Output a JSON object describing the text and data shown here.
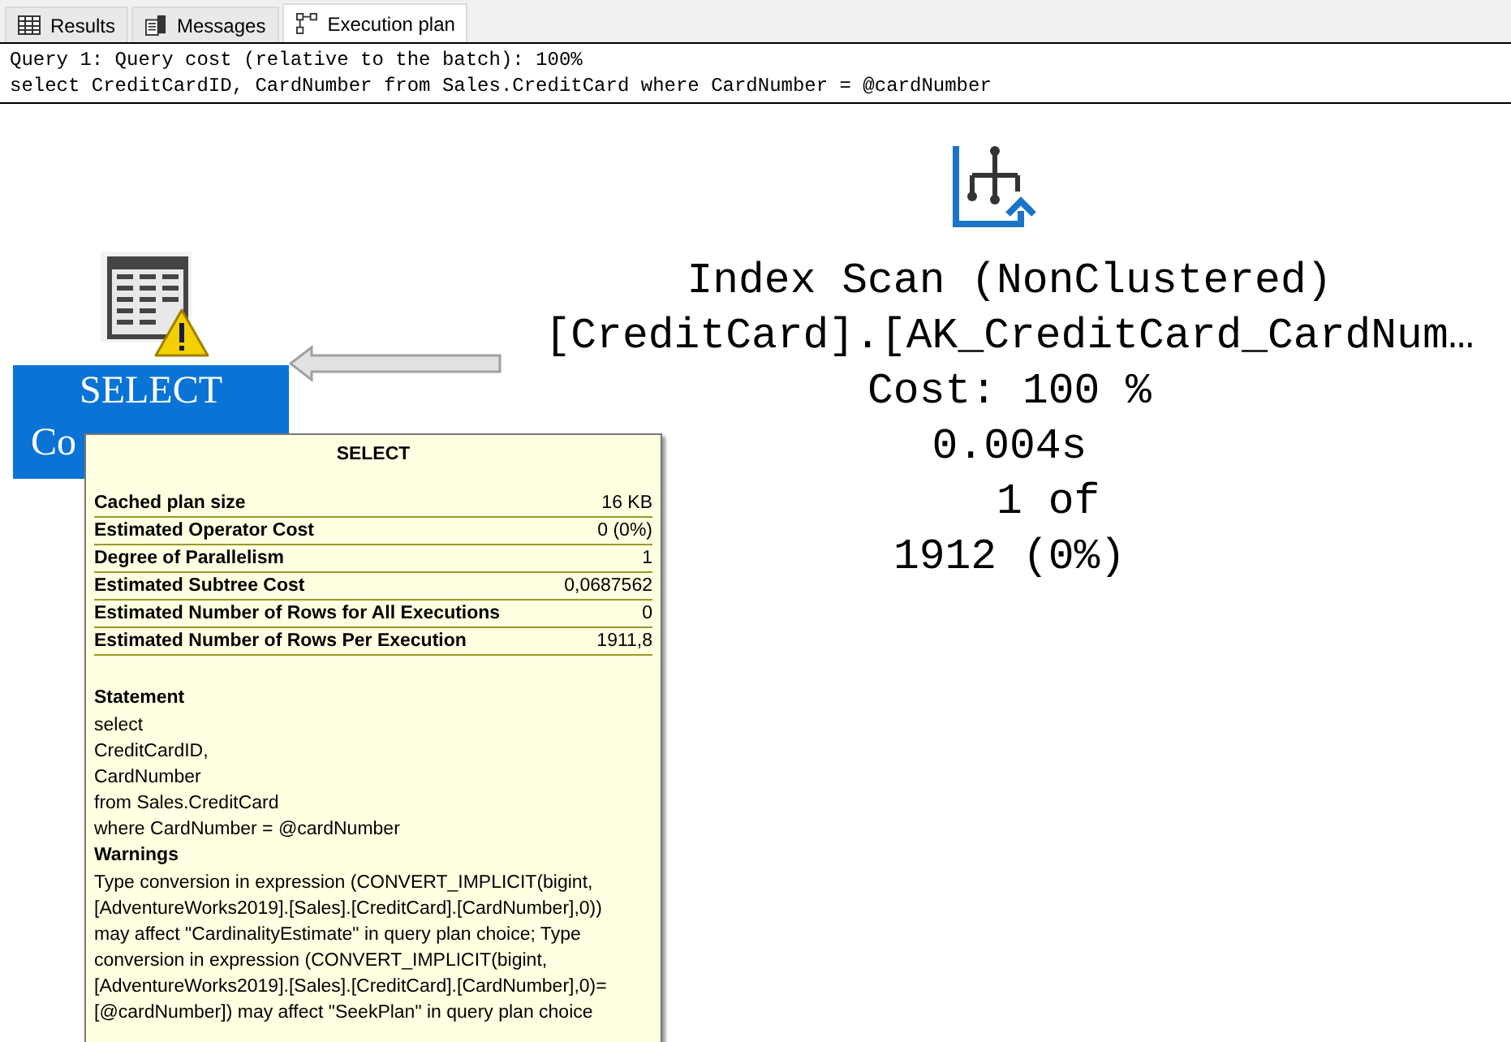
{
  "tabs": [
    {
      "label": "Results",
      "kind": "grid",
      "selected": false
    },
    {
      "label": "Messages",
      "kind": "messages",
      "selected": false
    },
    {
      "label": "Execution plan",
      "kind": "plan",
      "selected": true
    }
  ],
  "query_header": [
    "Query 1: Query cost (relative to the batch): 100%",
    "select CreditCardID, CardNumber from Sales.CreditCard where CardNumber = @cardNumber"
  ],
  "plan": {
    "select_node": {
      "lines": [
        "SELECT",
        "Co"
      ],
      "selected": true,
      "warning": true
    },
    "scan_node": {
      "lines": [
        "Index Scan (NonClustered)",
        "[CreditCard].[AK_CreditCard_CardNum…",
        "Cost: 100 %",
        "0.004s",
        "   1 of",
        "1912 (0%)"
      ]
    }
  },
  "tooltip": {
    "title": "SELECT",
    "properties": [
      {
        "name": "Cached plan size",
        "value": "16 KB"
      },
      {
        "name": "Estimated Operator Cost",
        "value": "0 (0%)"
      },
      {
        "name": "Degree of Parallelism",
        "value": "1"
      },
      {
        "name": "Estimated Subtree Cost",
        "value": "0,0687562"
      },
      {
        "name": "Estimated Number of Rows for All Executions",
        "value": "0"
      },
      {
        "name": "Estimated Number of Rows Per Execution",
        "value": "1911,8"
      }
    ],
    "sections": [
      {
        "heading": "Statement",
        "lines": [
          "select",
          "CreditCardID,",
          "CardNumber",
          "from Sales.CreditCard",
          "where CardNumber = @cardNumber"
        ]
      },
      {
        "heading": "Warnings",
        "lines": [
          "Type conversion in expression (CONVERT_IMPLICIT(bigint,",
          "[AdventureWorks2019].[Sales].[CreditCard].[CardNumber],0))",
          "may affect \"CardinalityEstimate\" in query plan choice; Type",
          "conversion in expression (CONVERT_IMPLICIT(bigint,",
          "[AdventureWorks2019].[Sales].[CreditCard].[CardNumber],0)=",
          "[@cardNumber]) may affect \"SeekPlan\" in query plan choice"
        ]
      }
    ]
  }
}
